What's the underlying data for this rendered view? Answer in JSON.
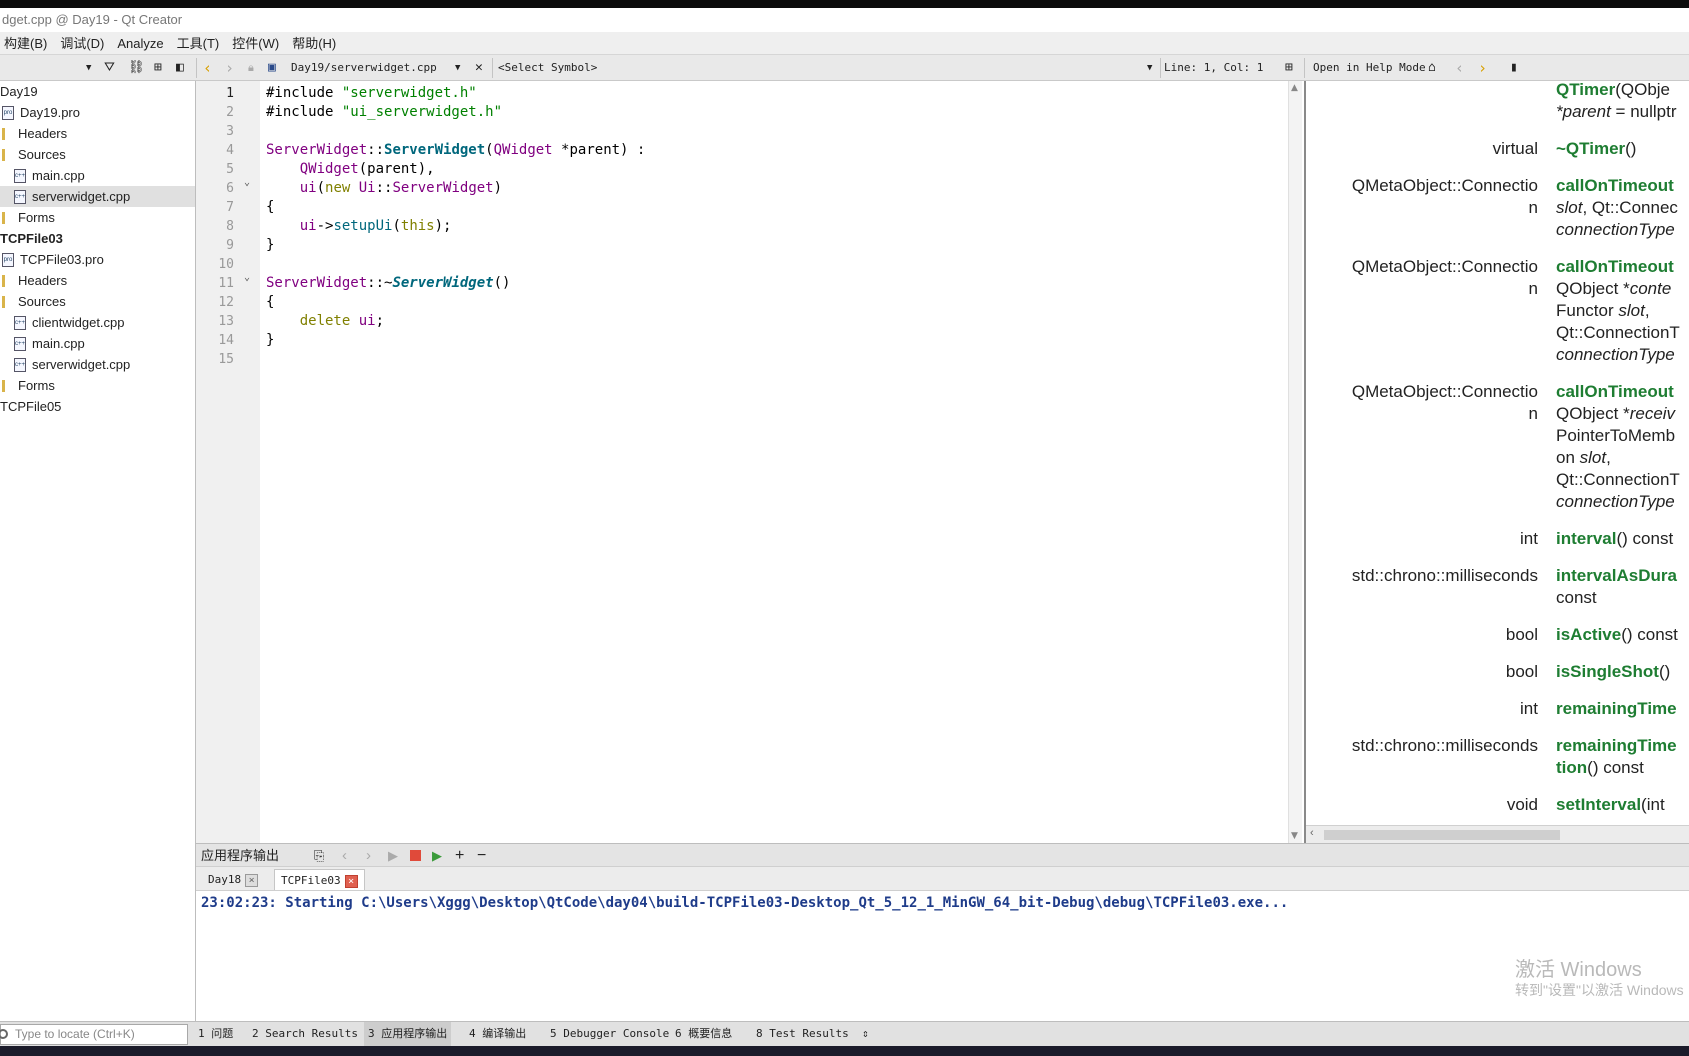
{
  "window": {
    "title": "dget.cpp @ Day19 - Qt Creator"
  },
  "menu": [
    "构建(B)",
    "调试(D)",
    "Analyze",
    "工具(T)",
    "控件(W)",
    "帮助(H)"
  ],
  "toolbar": {
    "file_name": "Day19/serverwidget.cpp",
    "symbol": "<Select Symbol>",
    "position": "Line: 1, Col: 1",
    "help_mode": "Open in Help Mode"
  },
  "project_tree": [
    {
      "label": "Day19",
      "indent": 0,
      "kind": "project",
      "bold": false
    },
    {
      "label": "Day19.pro",
      "indent": 1,
      "kind": "pro",
      "bold": false
    },
    {
      "label": "Headers",
      "indent": 1,
      "kind": "folder",
      "bold": false
    },
    {
      "label": "Sources",
      "indent": 1,
      "kind": "folder",
      "bold": false
    },
    {
      "label": "main.cpp",
      "indent": 2,
      "kind": "cpp",
      "bold": false
    },
    {
      "label": "serverwidget.cpp",
      "indent": 2,
      "kind": "cpp",
      "bold": false,
      "selected": true
    },
    {
      "label": "Forms",
      "indent": 1,
      "kind": "folder",
      "bold": false
    },
    {
      "label": "TCPFile03",
      "indent": 0,
      "kind": "project",
      "bold": true
    },
    {
      "label": "TCPFile03.pro",
      "indent": 1,
      "kind": "pro",
      "bold": false
    },
    {
      "label": "Headers",
      "indent": 1,
      "kind": "folder",
      "bold": false
    },
    {
      "label": "Sources",
      "indent": 1,
      "kind": "folder",
      "bold": false
    },
    {
      "label": "clientwidget.cpp",
      "indent": 2,
      "kind": "cpp",
      "bold": false
    },
    {
      "label": "main.cpp",
      "indent": 2,
      "kind": "cpp",
      "bold": false
    },
    {
      "label": "serverwidget.cpp",
      "indent": 2,
      "kind": "cpp",
      "bold": false
    },
    {
      "label": "Forms",
      "indent": 1,
      "kind": "folder",
      "bold": false
    },
    {
      "label": "TCPFile05",
      "indent": 0,
      "kind": "project",
      "bold": false
    }
  ],
  "editor": {
    "current_line": 1,
    "fold_lines": [
      6,
      11
    ],
    "lines": [
      [
        [
          "plain",
          "#include "
        ],
        [
          "str",
          "\"serverwidget.h\""
        ]
      ],
      [
        [
          "plain",
          "#include "
        ],
        [
          "str",
          "\"ui_serverwidget.h\""
        ]
      ],
      [],
      [
        [
          "typ",
          "ServerWidget"
        ],
        [
          "plain",
          "::"
        ],
        [
          "fnb",
          "ServerWidget"
        ],
        [
          "plain",
          "("
        ],
        [
          "typ",
          "QWidget"
        ],
        [
          "plain",
          " *parent) :"
        ]
      ],
      [
        [
          "plain",
          "    "
        ],
        [
          "typ",
          "QWidget"
        ],
        [
          "plain",
          "(parent),"
        ]
      ],
      [
        [
          "plain",
          "    "
        ],
        [
          "typ",
          "ui"
        ],
        [
          "plain",
          "("
        ],
        [
          "kw",
          "new"
        ],
        [
          "plain",
          " "
        ],
        [
          "typ",
          "Ui"
        ],
        [
          "plain",
          "::"
        ],
        [
          "typ",
          "ServerWidget"
        ],
        [
          "plain",
          ")"
        ]
      ],
      [
        [
          "plain",
          "{"
        ]
      ],
      [
        [
          "plain",
          "    "
        ],
        [
          "typ",
          "ui"
        ],
        [
          "plain",
          "->"
        ],
        [
          "fn",
          "setupUi"
        ],
        [
          "plain",
          "("
        ],
        [
          "kw",
          "this"
        ],
        [
          "plain",
          ");"
        ]
      ],
      [
        [
          "plain",
          "}"
        ]
      ],
      [],
      [
        [
          "typ",
          "ServerWidget"
        ],
        [
          "plain",
          "::~"
        ],
        [
          "fni",
          "ServerWidget"
        ],
        [
          "plain",
          "()"
        ]
      ],
      [
        [
          "plain",
          "{"
        ]
      ],
      [
        [
          "plain",
          "    "
        ],
        [
          "kw",
          "delete"
        ],
        [
          "plain",
          " "
        ],
        [
          "typ",
          "ui"
        ],
        [
          "plain",
          ";"
        ]
      ],
      [
        [
          "plain",
          "}"
        ]
      ],
      []
    ]
  },
  "help_rows": [
    {
      "type": "",
      "lines": [
        [
          [
            "green",
            "QTimer"
          ],
          [
            "plain",
            "(QObje"
          ]
        ],
        [
          [
            "it",
            "*parent"
          ],
          [
            "plain",
            " = nullptr"
          ]
        ]
      ]
    },
    {
      "type": "virtual",
      "lines": [
        [
          [
            "green",
            "~QTimer"
          ],
          [
            "plain",
            "()"
          ]
        ]
      ]
    },
    {
      "type": "QMetaObject::Connection",
      "lines": [
        [
          [
            "green",
            "callOnTimeout"
          ]
        ],
        [
          [
            "it",
            "slot"
          ],
          [
            "plain",
            ", Qt::Connec"
          ]
        ],
        [
          [
            "it",
            "connectionType"
          ]
        ]
      ]
    },
    {
      "type": "QMetaObject::Connection",
      "lines": [
        [
          [
            "green",
            "callOnTimeout"
          ]
        ],
        [
          [
            "plain",
            "QObject *"
          ],
          [
            "it",
            "conte"
          ]
        ],
        [
          [
            "plain",
            "Functor "
          ],
          [
            "it",
            "slot"
          ],
          [
            "plain",
            ","
          ]
        ],
        [
          [
            "plain",
            "Qt::ConnectionT"
          ]
        ],
        [
          [
            "it",
            "connectionType"
          ]
        ]
      ]
    },
    {
      "type": "QMetaObject::Connection",
      "lines": [
        [
          [
            "green",
            "callOnTimeout"
          ]
        ],
        [
          [
            "plain",
            "QObject *"
          ],
          [
            "it",
            "receiv"
          ]
        ],
        [
          [
            "plain",
            "PointerToMemb"
          ]
        ],
        [
          [
            "plain",
            "on "
          ],
          [
            "it",
            "slot"
          ],
          [
            "plain",
            ","
          ]
        ],
        [
          [
            "plain",
            "Qt::ConnectionT"
          ]
        ],
        [
          [
            "it",
            "connectionType"
          ]
        ]
      ]
    },
    {
      "type": "int",
      "lines": [
        [
          [
            "green",
            "interval"
          ],
          [
            "plain",
            "() const"
          ]
        ]
      ]
    },
    {
      "type": "std::chrono::milliseconds",
      "lines": [
        [
          [
            "green",
            "intervalAsDura"
          ]
        ],
        [
          [
            "plain",
            "const"
          ]
        ]
      ]
    },
    {
      "type": "bool",
      "lines": [
        [
          [
            "green",
            "isActive"
          ],
          [
            "plain",
            "() const"
          ]
        ]
      ]
    },
    {
      "type": "bool",
      "lines": [
        [
          [
            "green",
            "isSingleShot"
          ],
          [
            "plain",
            "()"
          ]
        ]
      ]
    },
    {
      "type": "int",
      "lines": [
        [
          [
            "green",
            "remainingTime"
          ]
        ]
      ]
    },
    {
      "type": "std::chrono::milliseconds",
      "lines": [
        [
          [
            "green",
            "remainingTime"
          ]
        ],
        [
          [
            "green",
            "tion"
          ],
          [
            "plain",
            "() const"
          ]
        ]
      ]
    },
    {
      "type": "void",
      "lines": [
        [
          [
            "green",
            "setInterval"
          ],
          [
            "plain",
            "(int"
          ]
        ]
      ]
    }
  ],
  "output": {
    "title": "应用程序输出",
    "tabs": [
      "Day18",
      "TCPFile03"
    ],
    "active_tab": 1,
    "text": "23:02:23: Starting C:\\Users\\Xggg\\Desktop\\QtCode\\day04\\build-TCPFile03-Desktop_Qt_5_12_1_MinGW_64_bit-Debug\\debug\\TCPFile03.exe..."
  },
  "watermark": {
    "line1": "激活 Windows",
    "line2": "转到\"设置\"以激活 Windows"
  },
  "statusbar": {
    "locate_placeholder": "Type to locate (Ctrl+K)",
    "panes": [
      {
        "label": "1 问题",
        "active": false
      },
      {
        "label": "2 Search Results",
        "active": false
      },
      {
        "label": "3 应用程序输出",
        "active": true
      },
      {
        "label": "4 编译输出",
        "active": false
      },
      {
        "label": "5 Debugger Console",
        "active": false
      },
      {
        "label": "6 概要信息",
        "active": false
      },
      {
        "label": "8 Test Results",
        "active": false
      }
    ]
  }
}
